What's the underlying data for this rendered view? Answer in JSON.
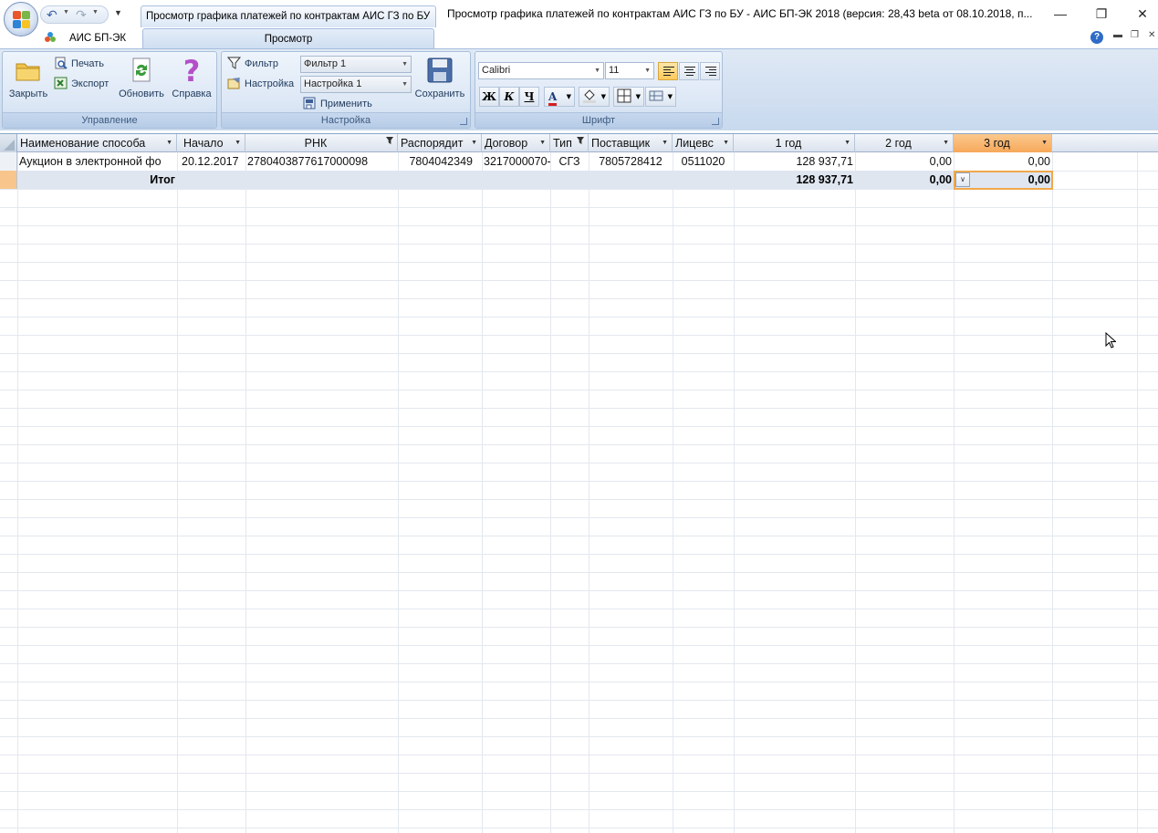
{
  "window": {
    "doc_tab_title": "Просмотр графика платежей по контрактам АИС ГЗ по БУ",
    "title": "Просмотр графика платежей по контрактам АИС ГЗ по БУ - АИС БП-ЭК 2018 (версия: 28,43 beta от 08.10.2018, п...",
    "minimize": "—",
    "restore": "❐",
    "close": "✕"
  },
  "quick_access": {
    "undo": "↶",
    "redo": "↷",
    "customize": "▼"
  },
  "ribbon_tabs": {
    "app_tab": "АИС БП-ЭК",
    "view_tab": "Просмотр",
    "help": "?"
  },
  "groups": {
    "manage": {
      "label": "Управление",
      "close": "Закрыть",
      "print": "Печать",
      "export": "Экспорт",
      "refresh": "Обновить",
      "help": "Справка"
    },
    "settings": {
      "label": "Настройка",
      "filter_label": "Фильтр",
      "filter_value": "Фильтр 1",
      "settings_label": "Настройка",
      "settings_value": "Настройка 1",
      "apply": "Применить",
      "save": "Сохранить"
    },
    "font": {
      "label": "Шрифт",
      "font_name": "Calibri",
      "font_size": "11",
      "bold": "Ж",
      "italic": "К",
      "underline": "Ч",
      "font_color_letter": "A"
    }
  },
  "grid": {
    "columns": [
      {
        "label": "Наименование способа"
      },
      {
        "label": "Начало"
      },
      {
        "label": "РНК"
      },
      {
        "label": "Распорядит"
      },
      {
        "label": "Договор"
      },
      {
        "label": "Тип"
      },
      {
        "label": "Поставщик"
      },
      {
        "label": "Лицевс"
      },
      {
        "label": "1 год"
      },
      {
        "label": "2 год"
      },
      {
        "label": "3 год"
      }
    ],
    "rows": [
      {
        "method": "Аукцион в электронной фо",
        "start": "20.12.2017",
        "rnk": "2780403877617000098",
        "manager": "7804042349",
        "contract": "3217000070-",
        "type": "СГЗ",
        "supplier": "7805728412",
        "account": "0511020",
        "year1": "128 937,71",
        "year2": "0,00",
        "year3": "0,00"
      }
    ],
    "totals": {
      "label": "Итог",
      "year1": "128 937,71",
      "year2": "0,00",
      "year3": "0,00"
    }
  },
  "colors": {
    "ribbon_top": "#dfe9f5",
    "selected_header": "#f6a85a",
    "current_cell_border": "#f0a84c",
    "total_row": "#dfe6f0"
  }
}
